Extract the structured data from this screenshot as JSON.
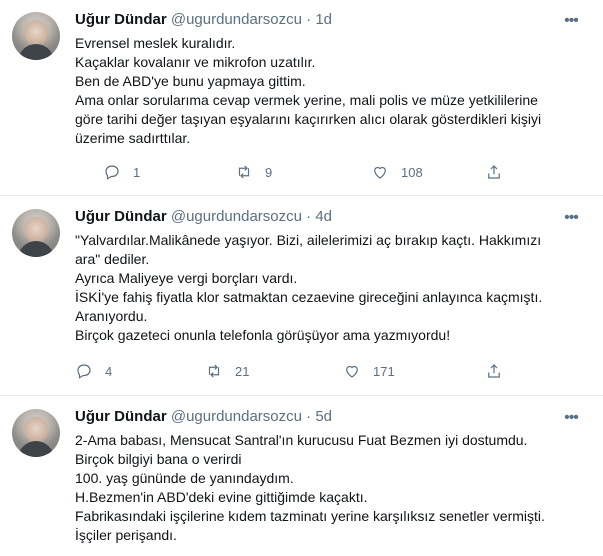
{
  "tweets": [
    {
      "name": "Uğur Dündar",
      "handle": "@ugurdundarsozcu",
      "dot": "·",
      "time": "1d",
      "lines": [
        "Evrensel meslek kuralıdır.",
        "Kaçaklar kovalanır ve mikrofon uzatılır.",
        "Ben de ABD'ye bunu yapmaya gittim.",
        "Ama onlar sorularıma cevap vermek yerine, mali polis ve müze yetkililerine",
        "göre tarihi değer taşıyan eşyalarını kaçırırken alıcı olarak gösterdikleri kişiyi",
        "üzerime sadırttılar."
      ],
      "replies": "1",
      "retweets": "9",
      "likes": "108"
    },
    {
      "name": "Uğur Dündar",
      "handle": "@ugurdundarsozcu",
      "dot": "·",
      "time": "4d",
      "lines": [
        "\"Yalvardılar.Malikânede yaşıyor. Bizi, ailelerimizi aç bırakıp kaçtı. Hakkımızı",
        "ara\" dediler.",
        "Ayrıca Maliyeye vergi borçları vardı.",
        "İSKİ'ye fahiş fiyatla klor satmaktan cezaevine gireceğini anlayınca kaçmıştı.",
        "Aranıyordu.",
        "Birçok gazeteci onunla telefonla görüşüyor ama yazmıyordu!"
      ],
      "replies": "4",
      "retweets": "21",
      "likes": "171"
    },
    {
      "name": "Uğur Dündar",
      "handle": "@ugurdundarsozcu",
      "dot": "·",
      "time": "5d",
      "lines": [
        "2-Ama babası, Mensucat Santral'ın kurucusu Fuat Bezmen iyi dostumdu.",
        "Birçok bilgiyi bana o verirdi",
        "100. yaş gününde de yanındaydım.",
        "H.Bezmen'in ABD'deki evine gittiğimde kaçaktı.",
        "Fabrikasındaki işçilerine kıdem tazminatı yerine karşılıksız senetler vermişti.",
        "İşçiler perişandı."
      ],
      "replies": "",
      "retweets": "",
      "likes": ""
    }
  ],
  "more_glyph": "•••",
  "icons": {
    "reply": "reply-icon",
    "retweet": "retweet-icon",
    "like": "like-icon",
    "share": "share-icon",
    "more": "more-icon"
  },
  "colors": {
    "text": "#0f1419",
    "secondary": "#5b7083",
    "divider": "#e6ecf0"
  }
}
